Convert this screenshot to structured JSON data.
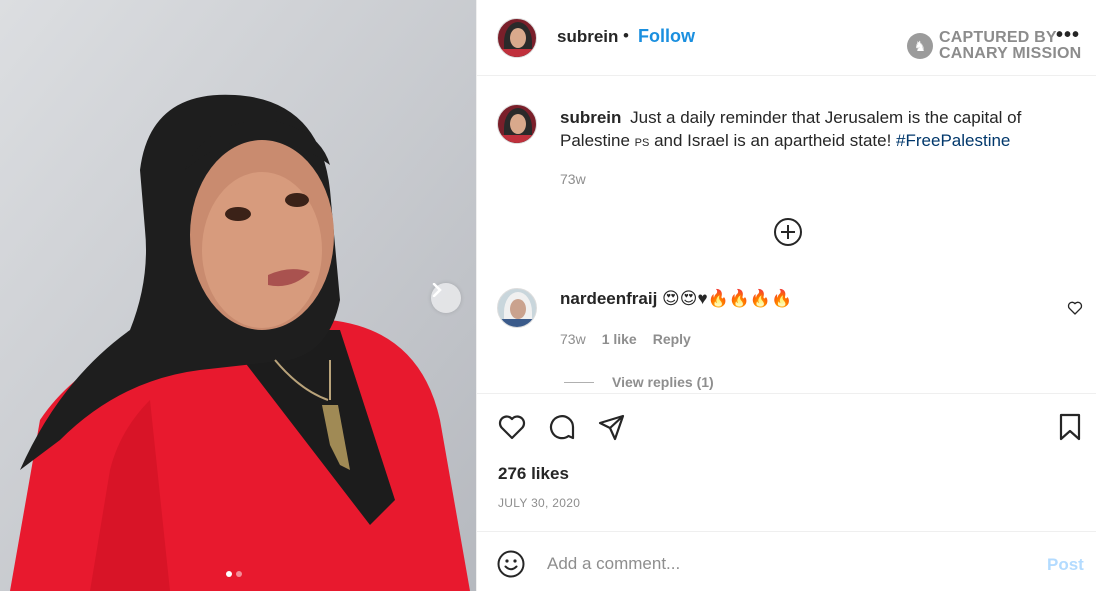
{
  "post": {
    "username": "subrein",
    "separator": "•",
    "follow_label": "Follow",
    "more_label": "•••",
    "watermark": {
      "line1": "CAPTURED BY",
      "line2": "CANARY MISSION"
    },
    "caption": {
      "username": "subrein",
      "text_before": "Just a daily reminder that Jerusalem is the capital of Palestine",
      "flag": "PS",
      "text_after": "and Israel is an apartheid state!",
      "hashtag": "#FreePalestine",
      "age": "73w"
    },
    "comment": {
      "username": "nardeenfraij",
      "text": "😍😍♥🔥🔥🔥🔥",
      "age": "73w",
      "likes": "1 like",
      "reply_label": "Reply",
      "view_replies": "View replies (1)"
    },
    "likes": "276 likes",
    "date": "JULY 30, 2020",
    "add_comment_placeholder": "Add a comment...",
    "post_label": "Post"
  },
  "carousel": {
    "count": 2,
    "active": 1
  }
}
